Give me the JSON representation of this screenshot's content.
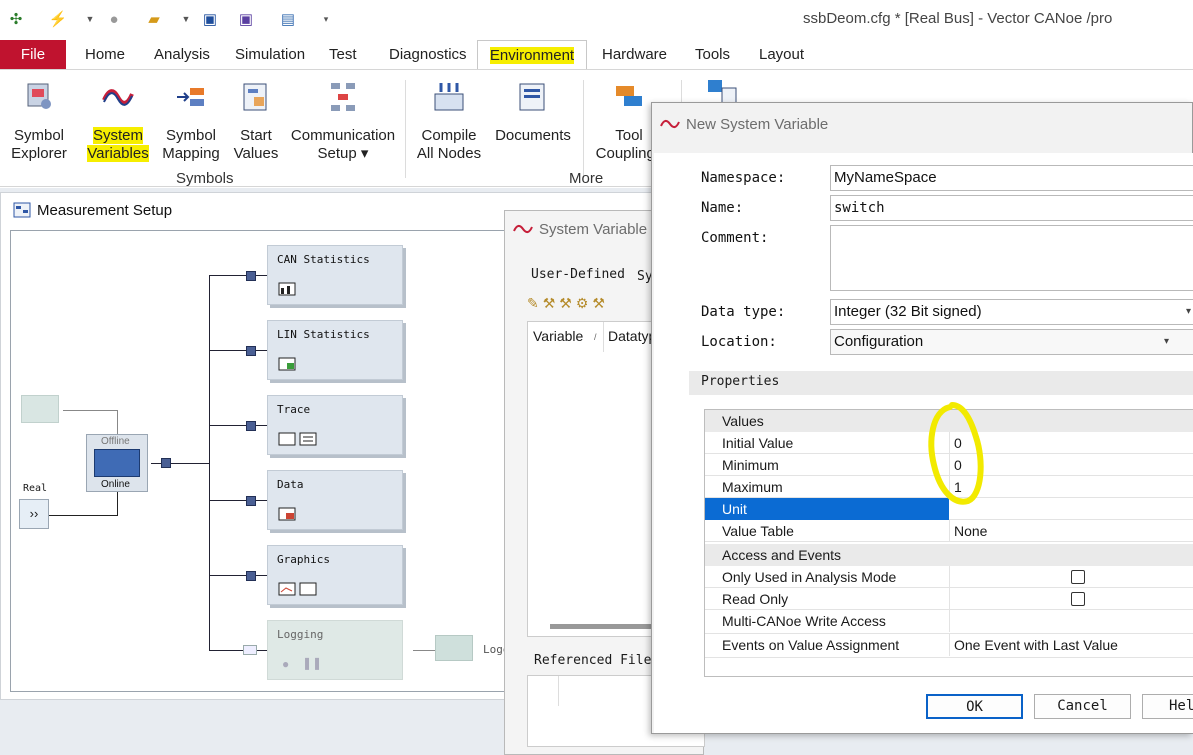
{
  "window": {
    "title": "ssbDeom.cfg * [Real Bus] - Vector CANoe /pro"
  },
  "ribbon": {
    "tabs": [
      "File",
      "Home",
      "Analysis",
      "Simulation",
      "Test",
      "Diagnostics",
      "Environment",
      "Hardware",
      "Tools",
      "Layout"
    ],
    "active_tab": "Environment",
    "buttons": {
      "symbol_explorer": [
        "Symbol",
        "Explorer"
      ],
      "system_variables": [
        "System",
        "Variables"
      ],
      "symbol_mapping": [
        "Symbol",
        "Mapping"
      ],
      "start_values": [
        "Start",
        "Values"
      ],
      "communication_setup": [
        "Communication",
        "Setup ▾"
      ],
      "compile_all_nodes": [
        "Compile",
        "All Nodes"
      ],
      "documents": [
        "Documents"
      ],
      "tool_couplings": [
        "Tool",
        "Couplings"
      ]
    },
    "groups": {
      "symbols": "Symbols",
      "more": "More"
    }
  },
  "measurement_setup": {
    "title": "Measurement Setup",
    "blocks": [
      "CAN Statistics",
      "LIN Statistics",
      "Trace",
      "Data",
      "Graphics",
      "Logging"
    ],
    "offline_label": "Offline",
    "online_label": "Online",
    "real_label": "Real",
    "logging_file_label": "Logg"
  },
  "system_variables_dialog": {
    "title": "System Variable",
    "tabs": [
      "User-Defined",
      "Sy"
    ],
    "columns": [
      "Variable",
      "Datatyp"
    ],
    "referenced_files": "Referenced File"
  },
  "new_system_variable": {
    "title": "New System Variable",
    "namespace_label": "Namespace:",
    "namespace_value": "MyNameSpace",
    "name_label": "Name:",
    "name_value": "switch",
    "comment_label": "Comment:",
    "comment_value": "",
    "datatype_label": "Data type:",
    "datatype_value": "Integer (32 Bit signed)",
    "location_label": "Location:",
    "location_value": "Configuration",
    "properties_label": "Properties",
    "values_header": "Values",
    "rows": [
      {
        "key": "Initial Value",
        "value": "0"
      },
      {
        "key": "Minimum",
        "value": "0"
      },
      {
        "key": "Maximum",
        "value": "1"
      },
      {
        "key": "Unit",
        "value": ""
      },
      {
        "key": "Value Table",
        "value": "None"
      }
    ],
    "access_header": "Access and Events",
    "access_rows": [
      {
        "key": "Only Used in Analysis Mode",
        "value": ""
      },
      {
        "key": "Read Only",
        "value": ""
      },
      {
        "key": "Multi-CANoe Write Access",
        "value": ""
      },
      {
        "key": "Events on Value Assignment",
        "value": "One Event with Last Value"
      }
    ],
    "buttons": {
      "ok": "OK",
      "cancel": "Cancel",
      "help": "Hel"
    }
  }
}
